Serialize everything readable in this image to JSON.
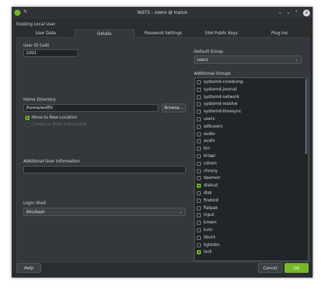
{
  "window": {
    "title": "YaST2 - users @ Icarus",
    "controls": [
      "⌄",
      "⌄",
      "⌃",
      "✕"
    ]
  },
  "panel_title": "Existing Local User",
  "tabs": [
    "User Data",
    "Details",
    "Password Settings",
    "SSH Public Keys",
    "Plug-Ins"
  ],
  "active_tab": "Details",
  "details": {
    "uid_label": "User ID (uid)",
    "uid_value": "1001",
    "home_label": "Home Directory",
    "home_value": "/home/wolfhl",
    "browse_label": "Browse...",
    "move_label": "Move to New Location",
    "move_checked": true,
    "btrfs_label": "Create as Btrfs Subvolume",
    "btrfs_checked": false,
    "addinfo_label": "Additional User Information",
    "addinfo_value": "",
    "shell_label": "Login Shell",
    "shell_value": "/bin/bash",
    "default_group_label": "Default Group",
    "default_group_value": "users",
    "groups_label": "Additional Groups",
    "groups": [
      {
        "name": "systemd-coredump",
        "checked": false
      },
      {
        "name": "systemd-journal",
        "checked": false
      },
      {
        "name": "systemd-network",
        "checked": false
      },
      {
        "name": "systemd-resolve",
        "checked": false
      },
      {
        "name": "systemd-timesync",
        "checked": false
      },
      {
        "name": "users",
        "checked": false
      },
      {
        "name": "adbusers",
        "checked": false
      },
      {
        "name": "audio",
        "checked": false
      },
      {
        "name": "avahi",
        "checked": false
      },
      {
        "name": "bin",
        "checked": false
      },
      {
        "name": "brlapi",
        "checked": false
      },
      {
        "name": "cdrom",
        "checked": false
      },
      {
        "name": "chrony",
        "checked": false
      },
      {
        "name": "daemon",
        "checked": false
      },
      {
        "name": "dialout",
        "checked": true
      },
      {
        "name": "disk",
        "checked": false
      },
      {
        "name": "firebird",
        "checked": false
      },
      {
        "name": "flatpak",
        "checked": false
      },
      {
        "name": "input",
        "checked": false
      },
      {
        "name": "kmem",
        "checked": false
      },
      {
        "name": "kvm",
        "checked": false
      },
      {
        "name": "libvirt",
        "checked": false
      },
      {
        "name": "lightdm",
        "checked": false
      },
      {
        "name": "lock",
        "checked": true
      }
    ]
  },
  "footer": {
    "help_label": "Help",
    "cancel_label": "Cancel",
    "ok_label": "OK"
  },
  "colors": {
    "accent": "#73ba25",
    "background": "#2b2e31"
  }
}
